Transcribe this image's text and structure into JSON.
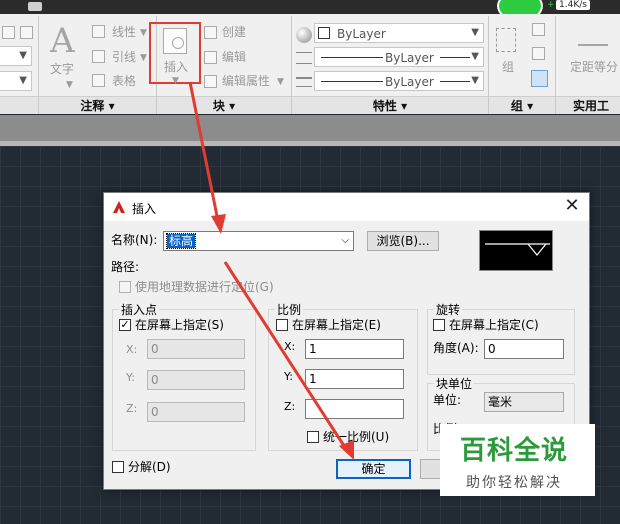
{
  "topbar": {
    "speed": "1.4K/s",
    "arrow": "+"
  },
  "ribbon": {
    "annotation": {
      "title": "注释",
      "text_label": "文字",
      "items": [
        "线性",
        "引线",
        "表格"
      ]
    },
    "block": {
      "title": "块",
      "insert_label": "插入",
      "items": [
        "创建",
        "编辑",
        "编辑属性"
      ]
    },
    "properties": {
      "title": "特性",
      "color": "ByLayer",
      "linetype": "ByLayer",
      "lineweight": "ByLayer"
    },
    "group": {
      "title": "组",
      "label": "组"
    },
    "utilities": {
      "title": "实用工具",
      "label": "定距等分"
    }
  },
  "dialog": {
    "title": "插入",
    "name_label": "名称(N):",
    "name_value": "标高",
    "browse_label": "浏览(B)...",
    "path_label": "路径:",
    "geo_label": "使用地理数据进行定位(G)",
    "insertion": {
      "title": "插入点",
      "onscreen_label": "在屏幕上指定(S)",
      "onscreen_checked": "✓",
      "x_label": "X:",
      "x_value": "0",
      "y_label": "Y:",
      "y_value": "0",
      "z_label": "Z:",
      "z_value": "0"
    },
    "scale": {
      "title": "比例",
      "onscreen_label": "在屏幕上指定(E)",
      "x_label": "X:",
      "x_value": "1",
      "y_label": "Y:",
      "y_value": "1",
      "z_label": "Z:",
      "z_value": "",
      "uniform_label": "统一比例(U)"
    },
    "rotation": {
      "title": "旋转",
      "onscreen_label": "在屏幕上指定(C)",
      "angle_label": "角度(A):",
      "angle_value": "0"
    },
    "block_unit": {
      "title": "块单位",
      "unit_label": "单位:",
      "unit_value": "毫米",
      "ratio_label": "比例:"
    },
    "explode_label": "分解(D)",
    "ok_label": "确定"
  },
  "watermark": {
    "main": "百科全说",
    "sub": "助你轻松解决"
  },
  "colors": {
    "annotation_red": "#e03c31",
    "accent_blue": "#0a64c8",
    "watermark_green": "#2c9a3a"
  }
}
